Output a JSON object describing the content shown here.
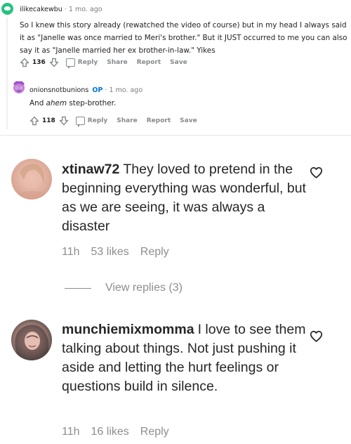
{
  "reddit": {
    "comment1": {
      "username": "ilikecakewbu",
      "time": "1 mo. ago",
      "body": "So I knew this story already (rewatched the video of course) but in my head I always said it as \"Janelle was once married to Meri's brother.\" But it JUST occurred to me you can also say it as \"Janelle married her ex brother-in-law.\" Yikes",
      "votes": "136",
      "actions": {
        "reply": "Reply",
        "share": "Share",
        "report": "Report",
        "save": "Save"
      }
    },
    "comment2": {
      "username": "onionsnotbunions",
      "op_badge": "OP",
      "time": "1 mo. ago",
      "body_prefix": "And ",
      "body_emph": "ahem",
      "body_suffix": " step-brother.",
      "votes": "118",
      "actions": {
        "reply": "Reply",
        "share": "Share",
        "report": "Report",
        "save": "Save"
      }
    },
    "separator": "·"
  },
  "instagram": {
    "comments": [
      {
        "username": "xtinaw72",
        "text": "They loved to pretend in the beginning everything was wonderful, but as we are seeing, it was always a disaster",
        "time": "11h",
        "likes": "53 likes",
        "reply": "Reply"
      },
      {
        "username": "munchiemixmomma",
        "text": "I love to see them talking about things. Not just pushing it aside and letting the hurt feelings or questions build in silence.",
        "time": "11h",
        "likes": "16 likes",
        "reply": "Reply"
      }
    ],
    "view_replies": "View replies (3)"
  },
  "colors": {
    "reddit_avatar1": "#27c281",
    "reddit_op_badge": "#0079d3",
    "reddit_action_gray": "#878a8c",
    "ig_text": "#262626",
    "ig_meta_gray": "#8e8e8e"
  }
}
